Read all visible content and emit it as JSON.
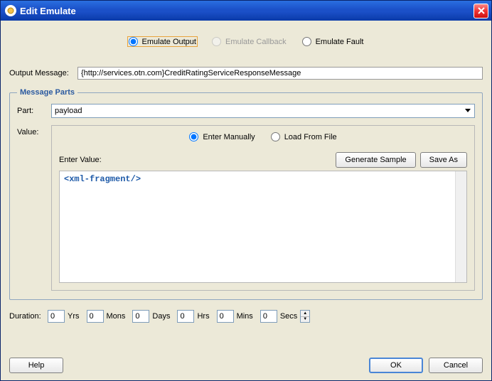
{
  "window": {
    "title": "Edit Emulate"
  },
  "modes": {
    "output": "Emulate Output",
    "callback": "Emulate Callback",
    "fault": "Emulate Fault"
  },
  "output_message": {
    "label": "Output Message:",
    "value": "{http://services.otn.com}CreditRatingServiceResponseMessage"
  },
  "message_parts": {
    "legend": "Message Parts",
    "part_label": "Part:",
    "part_value": "payload",
    "value_label": "Value:",
    "source": {
      "manual": "Enter Manually",
      "file": "Load From File"
    },
    "enter_value_label": "Enter Value:",
    "buttons": {
      "generate": "Generate Sample",
      "saveas": "Save As"
    },
    "code": "<xml-fragment/>"
  },
  "duration": {
    "label": "Duration:",
    "value": "0",
    "units": {
      "yrs": "Yrs",
      "mons": "Mons",
      "days": "Days",
      "hrs": "Hrs",
      "mins": "Mins",
      "secs": "Secs"
    }
  },
  "buttons": {
    "help": "Help",
    "ok": "OK",
    "cancel": "Cancel"
  }
}
